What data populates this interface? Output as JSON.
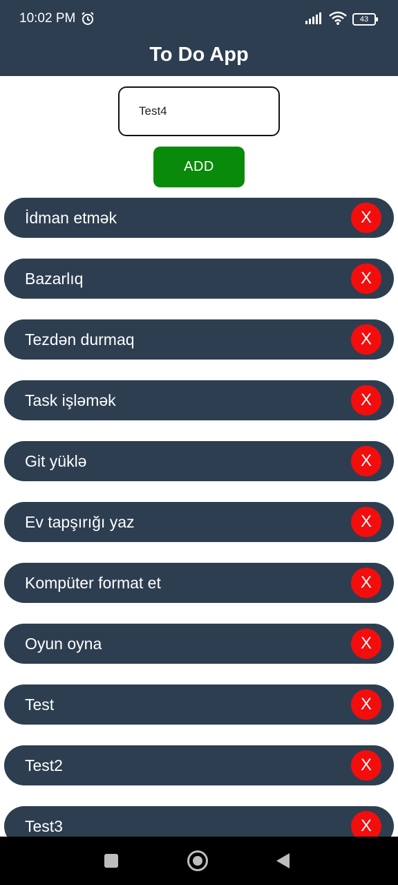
{
  "status_bar": {
    "time": "10:02 PM",
    "battery_level": "43",
    "icons": [
      "alarm-icon",
      "signal-icon",
      "wifi-icon",
      "battery-icon"
    ]
  },
  "app_bar": {
    "title": "To Do App"
  },
  "input": {
    "value": "Test4",
    "placeholder": ""
  },
  "add_button": {
    "label": "ADD"
  },
  "tasks": [
    {
      "text": "İdman etmək",
      "delete_label": "X"
    },
    {
      "text": "Bazarlıq",
      "delete_label": "X"
    },
    {
      "text": "Tezdən durmaq",
      "delete_label": "X"
    },
    {
      "text": "Task işləmək",
      "delete_label": "X"
    },
    {
      "text": "Git yüklə",
      "delete_label": "X"
    },
    {
      "text": "Ev tapşırığı yaz",
      "delete_label": "X"
    },
    {
      "text": "Kompüter format et",
      "delete_label": "X"
    },
    {
      "text": "Oyun oyna",
      "delete_label": "X"
    },
    {
      "text": "Test",
      "delete_label": "X"
    },
    {
      "text": "Test2",
      "delete_label": "X"
    },
    {
      "text": "Test3",
      "delete_label": "X"
    }
  ],
  "colors": {
    "header": "#2d3e50",
    "task_bg": "#2d3e50",
    "add_button": "#0a8a0a",
    "delete_button": "#f40d0d",
    "nav_bar": "#000000"
  },
  "nav_bar": {
    "icons": [
      "recent-apps-icon",
      "home-icon",
      "back-icon"
    ]
  }
}
